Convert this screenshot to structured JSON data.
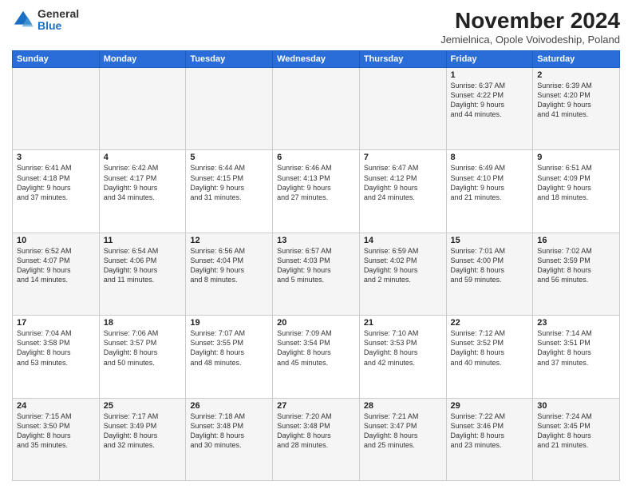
{
  "logo": {
    "general": "General",
    "blue": "Blue"
  },
  "title": "November 2024",
  "subtitle": "Jemielnica, Opole Voivodeship, Poland",
  "headers": [
    "Sunday",
    "Monday",
    "Tuesday",
    "Wednesday",
    "Thursday",
    "Friday",
    "Saturday"
  ],
  "rows": [
    [
      {
        "day": "",
        "info": ""
      },
      {
        "day": "",
        "info": ""
      },
      {
        "day": "",
        "info": ""
      },
      {
        "day": "",
        "info": ""
      },
      {
        "day": "",
        "info": ""
      },
      {
        "day": "1",
        "info": "Sunrise: 6:37 AM\nSunset: 4:22 PM\nDaylight: 9 hours\nand 44 minutes."
      },
      {
        "day": "2",
        "info": "Sunrise: 6:39 AM\nSunset: 4:20 PM\nDaylight: 9 hours\nand 41 minutes."
      }
    ],
    [
      {
        "day": "3",
        "info": "Sunrise: 6:41 AM\nSunset: 4:18 PM\nDaylight: 9 hours\nand 37 minutes."
      },
      {
        "day": "4",
        "info": "Sunrise: 6:42 AM\nSunset: 4:17 PM\nDaylight: 9 hours\nand 34 minutes."
      },
      {
        "day": "5",
        "info": "Sunrise: 6:44 AM\nSunset: 4:15 PM\nDaylight: 9 hours\nand 31 minutes."
      },
      {
        "day": "6",
        "info": "Sunrise: 6:46 AM\nSunset: 4:13 PM\nDaylight: 9 hours\nand 27 minutes."
      },
      {
        "day": "7",
        "info": "Sunrise: 6:47 AM\nSunset: 4:12 PM\nDaylight: 9 hours\nand 24 minutes."
      },
      {
        "day": "8",
        "info": "Sunrise: 6:49 AM\nSunset: 4:10 PM\nDaylight: 9 hours\nand 21 minutes."
      },
      {
        "day": "9",
        "info": "Sunrise: 6:51 AM\nSunset: 4:09 PM\nDaylight: 9 hours\nand 18 minutes."
      }
    ],
    [
      {
        "day": "10",
        "info": "Sunrise: 6:52 AM\nSunset: 4:07 PM\nDaylight: 9 hours\nand 14 minutes."
      },
      {
        "day": "11",
        "info": "Sunrise: 6:54 AM\nSunset: 4:06 PM\nDaylight: 9 hours\nand 11 minutes."
      },
      {
        "day": "12",
        "info": "Sunrise: 6:56 AM\nSunset: 4:04 PM\nDaylight: 9 hours\nand 8 minutes."
      },
      {
        "day": "13",
        "info": "Sunrise: 6:57 AM\nSunset: 4:03 PM\nDaylight: 9 hours\nand 5 minutes."
      },
      {
        "day": "14",
        "info": "Sunrise: 6:59 AM\nSunset: 4:02 PM\nDaylight: 9 hours\nand 2 minutes."
      },
      {
        "day": "15",
        "info": "Sunrise: 7:01 AM\nSunset: 4:00 PM\nDaylight: 8 hours\nand 59 minutes."
      },
      {
        "day": "16",
        "info": "Sunrise: 7:02 AM\nSunset: 3:59 PM\nDaylight: 8 hours\nand 56 minutes."
      }
    ],
    [
      {
        "day": "17",
        "info": "Sunrise: 7:04 AM\nSunset: 3:58 PM\nDaylight: 8 hours\nand 53 minutes."
      },
      {
        "day": "18",
        "info": "Sunrise: 7:06 AM\nSunset: 3:57 PM\nDaylight: 8 hours\nand 50 minutes."
      },
      {
        "day": "19",
        "info": "Sunrise: 7:07 AM\nSunset: 3:55 PM\nDaylight: 8 hours\nand 48 minutes."
      },
      {
        "day": "20",
        "info": "Sunrise: 7:09 AM\nSunset: 3:54 PM\nDaylight: 8 hours\nand 45 minutes."
      },
      {
        "day": "21",
        "info": "Sunrise: 7:10 AM\nSunset: 3:53 PM\nDaylight: 8 hours\nand 42 minutes."
      },
      {
        "day": "22",
        "info": "Sunrise: 7:12 AM\nSunset: 3:52 PM\nDaylight: 8 hours\nand 40 minutes."
      },
      {
        "day": "23",
        "info": "Sunrise: 7:14 AM\nSunset: 3:51 PM\nDaylight: 8 hours\nand 37 minutes."
      }
    ],
    [
      {
        "day": "24",
        "info": "Sunrise: 7:15 AM\nSunset: 3:50 PM\nDaylight: 8 hours\nand 35 minutes."
      },
      {
        "day": "25",
        "info": "Sunrise: 7:17 AM\nSunset: 3:49 PM\nDaylight: 8 hours\nand 32 minutes."
      },
      {
        "day": "26",
        "info": "Sunrise: 7:18 AM\nSunset: 3:48 PM\nDaylight: 8 hours\nand 30 minutes."
      },
      {
        "day": "27",
        "info": "Sunrise: 7:20 AM\nSunset: 3:48 PM\nDaylight: 8 hours\nand 28 minutes."
      },
      {
        "day": "28",
        "info": "Sunrise: 7:21 AM\nSunset: 3:47 PM\nDaylight: 8 hours\nand 25 minutes."
      },
      {
        "day": "29",
        "info": "Sunrise: 7:22 AM\nSunset: 3:46 PM\nDaylight: 8 hours\nand 23 minutes."
      },
      {
        "day": "30",
        "info": "Sunrise: 7:24 AM\nSunset: 3:45 PM\nDaylight: 8 hours\nand 21 minutes."
      }
    ]
  ]
}
